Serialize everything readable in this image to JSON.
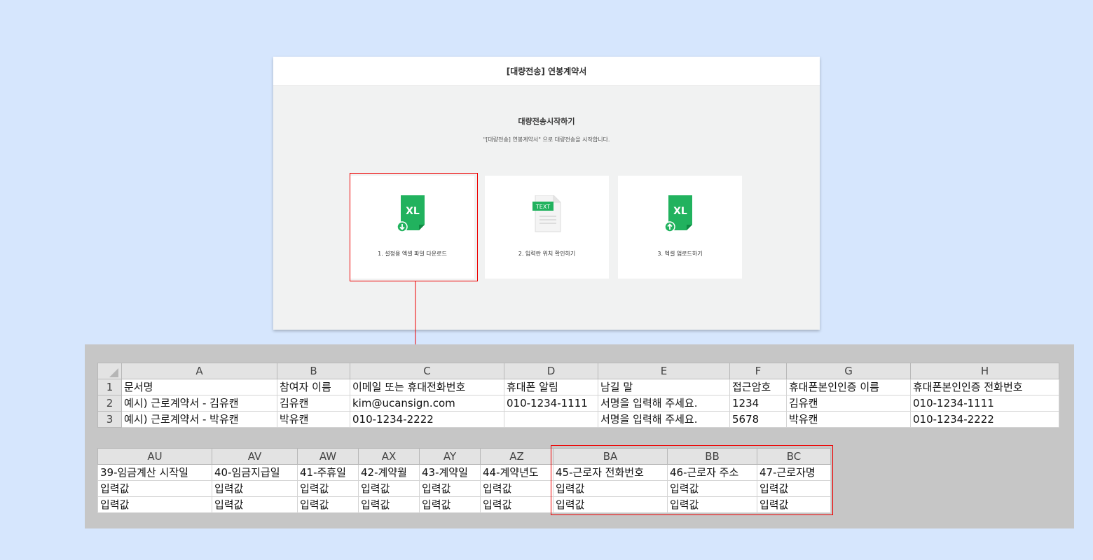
{
  "panel": {
    "title": "[대량전송] 연봉계약서",
    "start_title": "대량전송시작하기",
    "start_desc": "\"[대량전송] 연봉계약서\" 으로 대량전송을 시작합니다.",
    "cards": [
      {
        "label": "1. 설정용 엑셀 파일 다운로드",
        "icon": "excel-download-icon",
        "badge": "XL"
      },
      {
        "label": "2. 입력란 위치 확인하기",
        "icon": "text-file-icon",
        "badge": "TEXT"
      },
      {
        "label": "3. 엑셀 업로드하기",
        "icon": "excel-upload-icon",
        "badge": "XL"
      }
    ]
  },
  "sheet1": {
    "columns": [
      "A",
      "B",
      "C",
      "D",
      "E",
      "F",
      "G",
      "H"
    ],
    "rows": [
      {
        "num": "1",
        "cells": [
          "문서명",
          "참여자 이름",
          "이메일 또는 휴대전화번호",
          "휴대폰 알림",
          "남길 말",
          "접근암호",
          "휴대폰본인인증 이름",
          "휴대폰본인인증 전화번호"
        ]
      },
      {
        "num": "2",
        "cells": [
          "예시) 근로계약서 - 김유캔",
          "김유캔",
          "kim@ucansign.com",
          "010-1234-1111",
          "서명을 입력해 주세요.",
          "1234",
          "김유캔",
          "010-1234-1111"
        ]
      },
      {
        "num": "3",
        "cells": [
          "예시) 근로계약서 - 박유캔",
          "박유캔",
          "010-1234-2222",
          "",
          "서명을 입력해 주세요.",
          "5678",
          "박유캔",
          "010-1234-2222"
        ]
      }
    ]
  },
  "sheet2": {
    "columns": [
      "AU",
      "AV",
      "AW",
      "AX",
      "AY",
      "AZ",
      "BA",
      "BB",
      "BC"
    ],
    "rows": [
      {
        "cells": [
          "39-임금계산 시작일",
          "40-임금지급일",
          "41-주휴일",
          "42-계약월",
          "43-계약일",
          "44-계약년도",
          "45-근로자 전화번호",
          "46-근로자 주소",
          "47-근로자명"
        ]
      },
      {
        "cells": [
          "입력값",
          "입력값",
          "입력값",
          "입력값",
          "입력값",
          "입력값",
          "입력값",
          "입력값",
          "입력값"
        ]
      },
      {
        "cells": [
          "입력값",
          "입력값",
          "입력값",
          "입력값",
          "입력값",
          "입력값",
          "입력값",
          "입력값",
          "입력값"
        ]
      }
    ]
  },
  "colors": {
    "excel_green": "#21b25e",
    "highlight_red": "#e00000",
    "background": "#d6e6fd"
  }
}
